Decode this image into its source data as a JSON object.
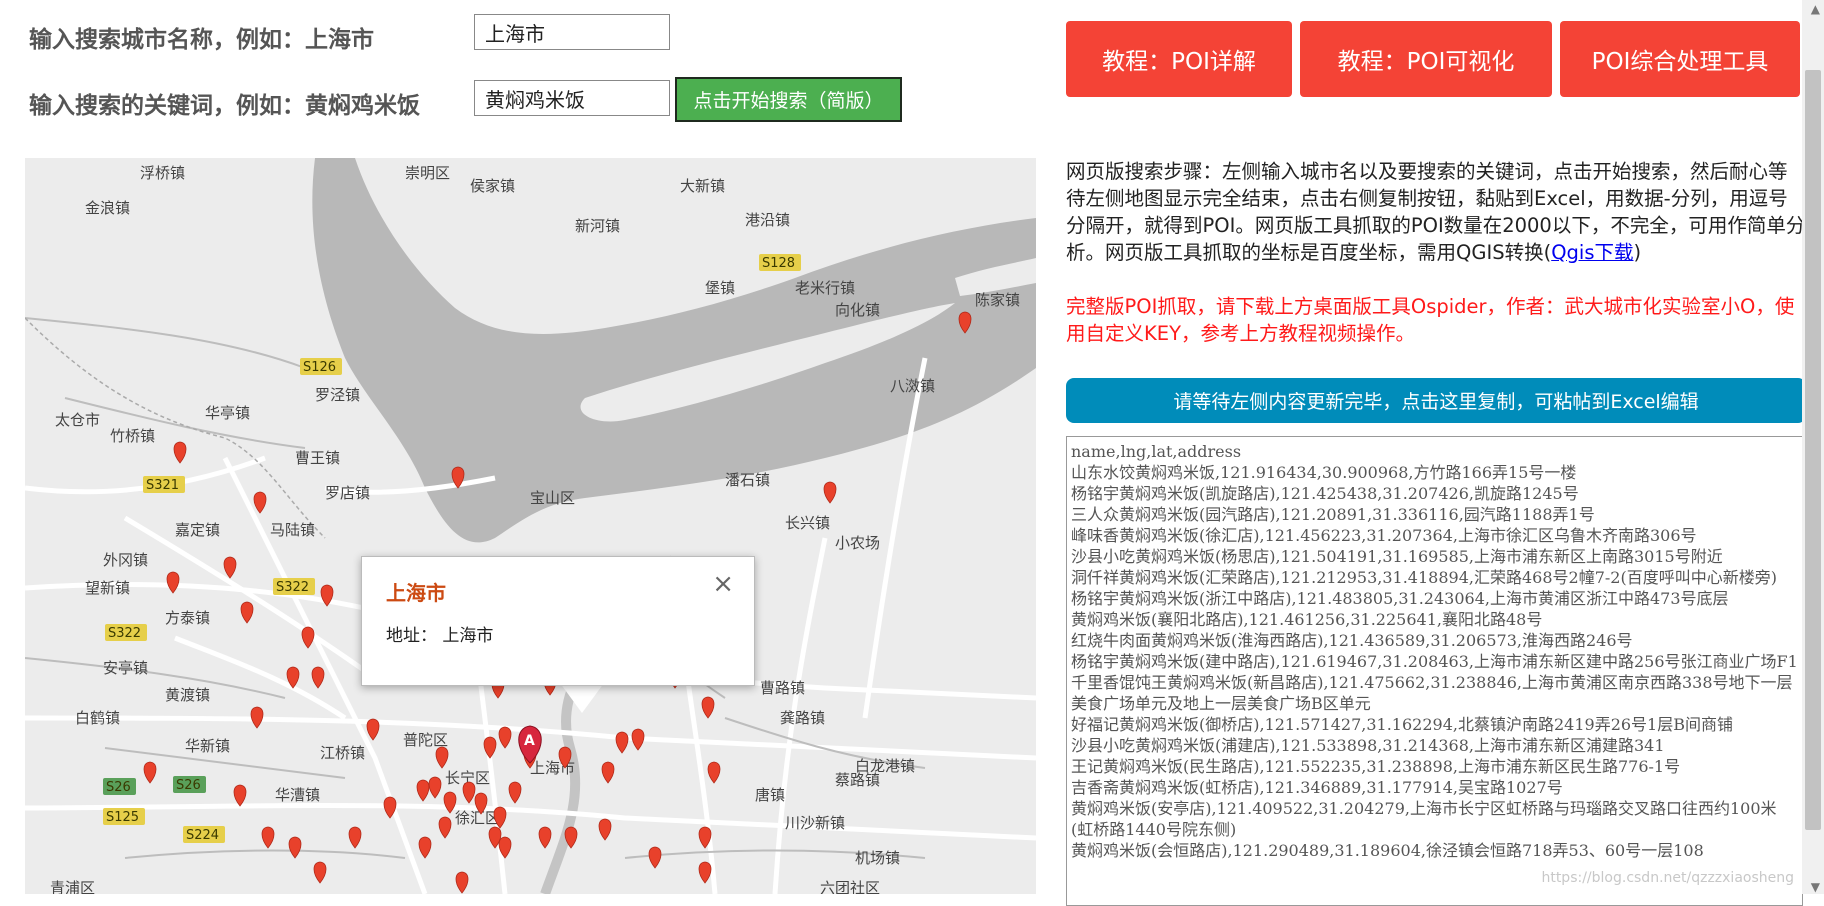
{
  "search": {
    "city_label": "输入搜索城市名称，例如：上海市",
    "city_value": "上海市",
    "keyword_label": "输入搜索的关键词，例如：黄焖鸡米饭",
    "keyword_value": "黄焖鸡米饭",
    "start_button": "点击开始搜索（简版）"
  },
  "top_buttons": [
    {
      "label": "教程：POI详解"
    },
    {
      "label": "教程：POI可视化"
    },
    {
      "label": "POI综合处理工具"
    }
  ],
  "instructions": {
    "text": "网页版搜索步骤：左侧输入城市名以及要搜索的关键词，点击开始搜索，然后耐心等待左侧地图显示完全结束，点击右侧复制按钮，黏贴到Excel，用数据-分列，用逗号分隔开，就得到POI。网页版工具抓取的POI数量在2000以下，不完全，可用作简单分析。网页版工具抓取的坐标是百度坐标，需用QGIS转换(",
    "link": "Qgis下载",
    "close": ")"
  },
  "notice": "完整版POI抓取，请下载上方桌面版工具Ospider，作者：武大城市化实验室小O，使用自定义KEY，参考上方教程视频操作。",
  "copy_button": "请等待左侧内容更新完毕，点击这里复制，可粘帖到Excel编辑",
  "results": [
    "name,lng,lat,address",
    "山东水饺黄焖鸡米饭,121.916434,30.900968,方竹路166弄15号一楼",
    "杨铭宇黄焖鸡米饭(凯旋路店),121.425438,31.207426,凯旋路1245号",
    "三人众黄焖鸡米饭(园汽路店),121.20891,31.336116,园汽路1188弄1号",
    "峰味香黄焖鸡米饭(徐汇店),121.456223,31.207364,上海市徐汇区乌鲁木齐南路306号",
    "沙县小吃黄焖鸡米饭(杨思店),121.504191,31.169585,上海市浦东新区上南路3015号附近",
    "洞仟祥黄焖鸡米饭(汇荣路店),121.212953,31.418894,汇荣路468号2幢7-2(百度呼叫中心新楼旁)",
    "杨铭宇黄焖鸡米饭(浙江中路店),121.483805,31.243064,上海市黄浦区浙江中路473号底层",
    "黄焖鸡米饭(襄阳北路店),121.461256,31.225641,襄阳北路48号",
    "红烧牛肉面黄焖鸡米饭(淮海西路店),121.436589,31.206573,淮海西路246号",
    "杨铭宇黄焖鸡米饭(建中路店),121.619467,31.208463,上海市浦东新区建中路256号张江商业广场F1",
    "千里香馄饨王黄焖鸡米饭(新昌路店),121.475662,31.238846,上海市黄浦区南京西路338号地下一层美食广场单元及地上一层美食广场B区单元",
    "好福记黄焖鸡米饭(御桥店),121.571427,31.162294,北蔡镇沪南路2419弄26号1层B间商铺",
    "沙县小吃黄焖鸡米饭(浦建店),121.533898,31.214368,上海市浦东新区浦建路341",
    "王记黄焖鸡米饭(民生路店),121.552235,31.238898,上海市浦东新区民生路776-1号",
    "吉香斋黄焖鸡米饭(虹桥店),121.346889,31.177914,吴宝路1027号",
    "黄焖鸡米饭(安亭店),121.409522,31.204279,上海市长宁区虹桥路与玛瑙路交叉路口往西约100米(虹桥路1440号院东侧)",
    "黄焖鸡米饭(会恒路店),121.290489,31.189604,徐泾镇会恒路718弄53、60号一层108"
  ],
  "map": {
    "places": [
      "浮桥镇",
      "崇明区",
      "侯家镇",
      "大新镇",
      "金浪镇",
      "新河镇",
      "港沿镇",
      "堡镇",
      "老米行镇",
      "向化镇",
      "陈家镇",
      "罗泾镇",
      "太仓市",
      "华亭镇",
      "竹桥镇",
      "曹王镇",
      "八滧镇",
      "罗店镇",
      "宝山区",
      "潘石镇",
      "嘉定镇",
      "马陆镇",
      "长兴镇",
      "小农场",
      "外冈镇",
      "望新镇",
      "方泰镇",
      "安亭镇",
      "白鹤镇",
      "黄渡镇",
      "华新镇",
      "江桥镇",
      "普陀区",
      "长宁区",
      "徐汇区",
      "华漕镇",
      "青浦区",
      "曹路镇",
      "龚路镇",
      "白龙港镇",
      "唐镇",
      "蔡路镇",
      "川沙新镇",
      "机场镇",
      "六团社区",
      "上海市"
    ],
    "shields": [
      "S128",
      "S126",
      "S321",
      "S322",
      "S322",
      "S26",
      "S26",
      "S125",
      "S224"
    ],
    "marker_label": "A"
  },
  "popup": {
    "title": "上海市",
    "close": "×",
    "address": "地址：   上海市"
  },
  "watermark": "https://blog.csdn.net/qzzzxiaosheng"
}
